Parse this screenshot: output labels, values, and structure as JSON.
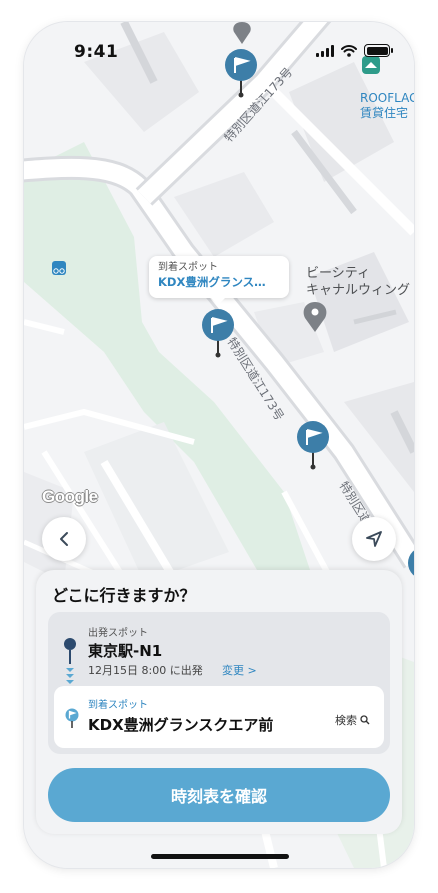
{
  "status_bar": {
    "time": "9:41"
  },
  "map": {
    "pois": {
      "rooflag_line1": "ROOFLAG",
      "rooflag_line2": "賃貸住宅",
      "bcity_line1": "ビーシティ",
      "bcity_line2": "キャナルウィング"
    },
    "road_label": "特別区道江173号",
    "road_label_short": "特別区道江",
    "callout": {
      "caption": "到着スポット",
      "name": "KDX豊洲グランス…"
    },
    "attribution": "Google",
    "icons": {
      "back": "chevron-left-icon",
      "locate": "navigation-arrow-icon",
      "pin": "flag-pin-icon"
    },
    "colors": {
      "pin": "#3d7ea8",
      "poi_blue": "#2f86c0",
      "park": "#dfeee4"
    }
  },
  "sheet": {
    "title": "どこに行きますか？",
    "departure": {
      "caption": "出発スポット",
      "name": "東京駅-N1",
      "datetime": "12月15日 8:00 に出発",
      "change_label": "変更 >"
    },
    "destination": {
      "caption": "到着スポット",
      "name": "KDX豊洲グランスクエア前",
      "search_label": "検索"
    },
    "confirm_label": "時刻表を確認",
    "colors": {
      "accent": "#5aa8d2",
      "link": "#2f86c0"
    }
  }
}
